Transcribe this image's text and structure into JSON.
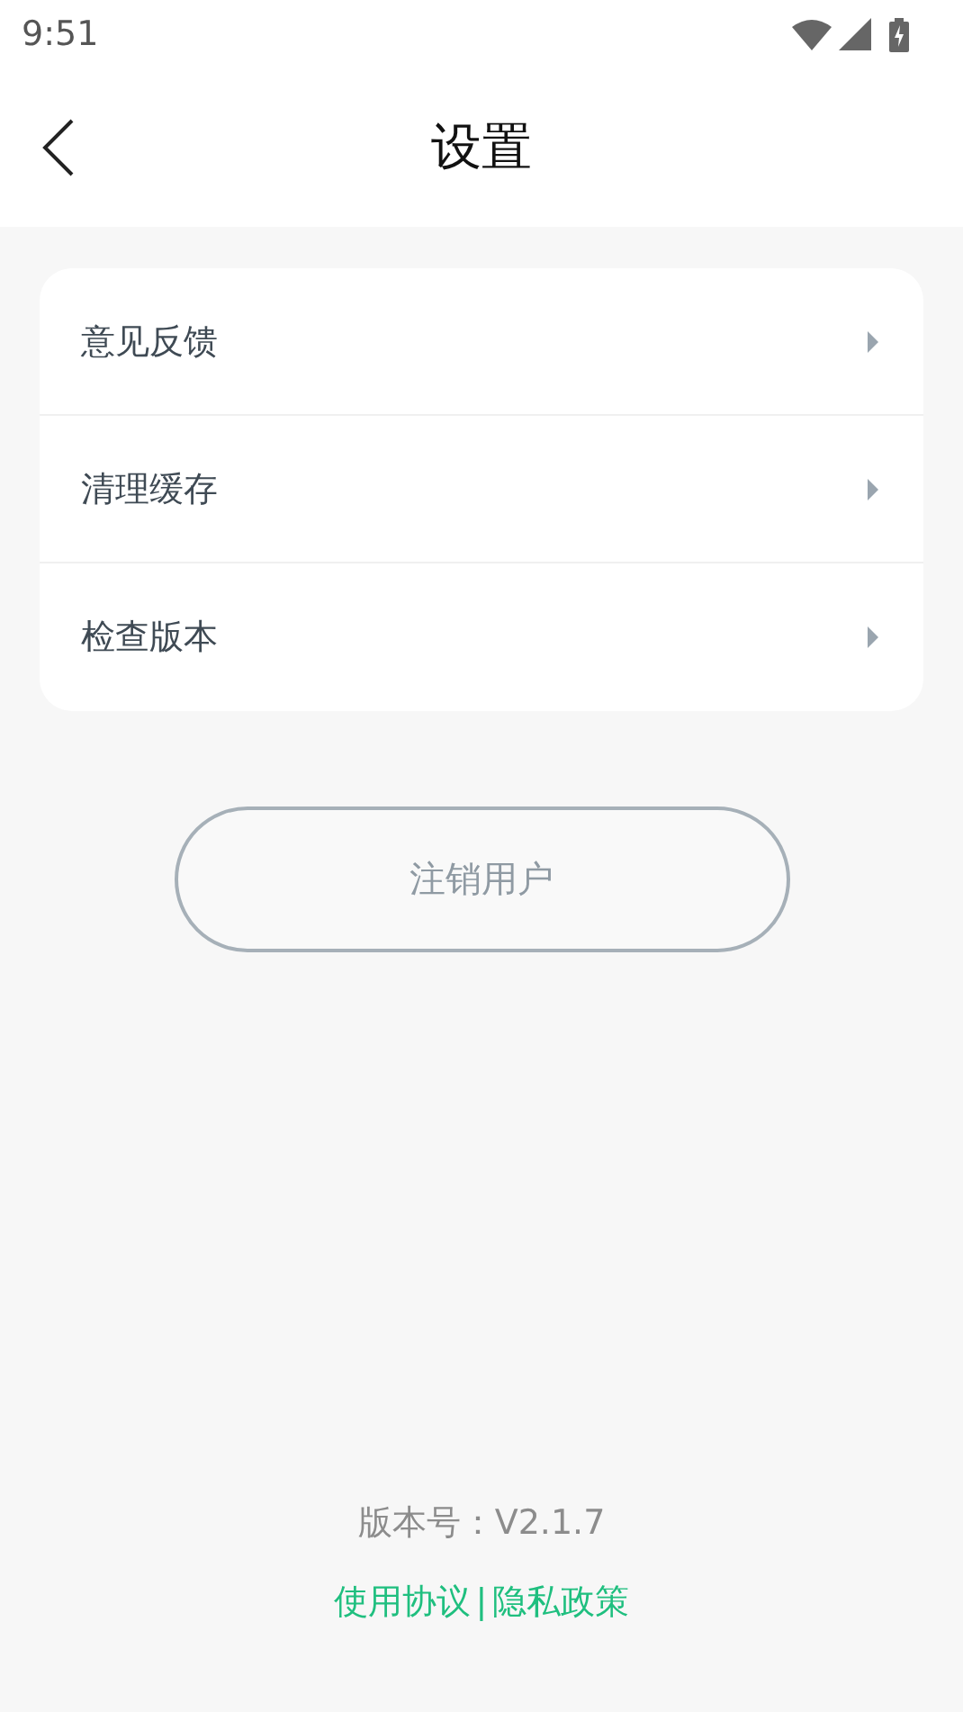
{
  "status_bar": {
    "time": "9:51"
  },
  "header": {
    "title": "设置"
  },
  "menu_items": [
    {
      "label": "意见反馈"
    },
    {
      "label": "清理缓存"
    },
    {
      "label": "检查版本"
    }
  ],
  "logout_button": {
    "label": "注销用户"
  },
  "footer": {
    "version": "版本号：V2.1.7",
    "links": [
      "使用协议",
      "隐私政策"
    ],
    "separator": "|"
  }
}
